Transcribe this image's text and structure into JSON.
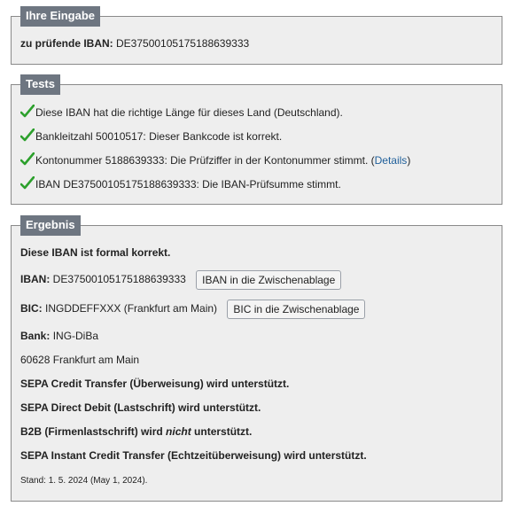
{
  "input": {
    "title": "Ihre Eingabe",
    "iban_label": "zu prüfende IBAN:",
    "iban_value": "DE37500105175188639333"
  },
  "tests": {
    "title": "Tests",
    "items": [
      {
        "text": "Diese IBAN hat die richtige Länge für dieses Land (Deutschland)."
      },
      {
        "text": "Bankleitzahl 50010517: Dieser Bankcode ist korrekt."
      },
      {
        "text_before": "Kontonummer 5188639333: Die Prüfziffer in der Kontonummer stimmt. (",
        "link": "Details",
        "text_after": ")"
      },
      {
        "text": "IBAN DE37500105175188639333: Die IBAN-Prüfsumme stimmt."
      }
    ],
    "check_color": "#2ca02c"
  },
  "result": {
    "title": "Ergebnis",
    "summary": "Diese IBAN ist formal korrekt.",
    "iban_label": "IBAN:",
    "iban_value": "DE37500105175188639333",
    "iban_button": "IBAN in die Zwischenablage",
    "bic_label": "BIC:",
    "bic_value": "INGDDEFFXXX (Frankfurt am Main)",
    "bic_button": "BIC in die Zwischenablage",
    "bank_label": "Bank:",
    "bank_value": "ING-DiBa",
    "city": "60628 Frankfurt am Main",
    "sepa_ct": "SEPA Credit Transfer (Überweisung) wird unterstützt.",
    "sepa_dd": "SEPA Direct Debit (Lastschrift) wird unterstützt.",
    "b2b_before": "B2B (Firmenlastschrift) wird ",
    "b2b_emph": "nicht",
    "b2b_after": " unterstützt.",
    "sepa_inst": "SEPA Instant Credit Transfer (Echtzeitüberweisung) wird unterstützt.",
    "stand": "Stand: 1. 5. 2024 (May 1, 2024)."
  },
  "colors": {
    "legend_bg": "#6e7681",
    "box_bg": "#eeeeee",
    "link": "#1f5f9a"
  }
}
